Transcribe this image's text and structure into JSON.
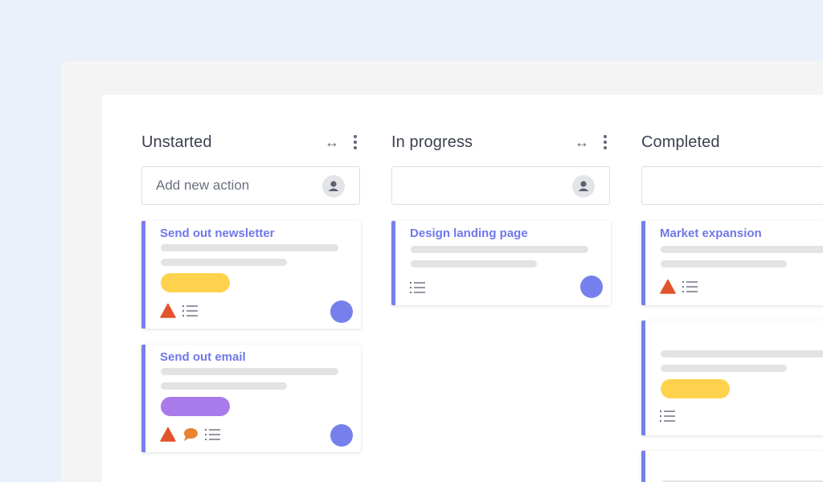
{
  "colors": {
    "accent": "#7680ec",
    "tag_yellow": "#ffd24e",
    "tag_purple": "#a97bea",
    "warning": "#e0552b",
    "comment": "#e8832e"
  },
  "columns": [
    {
      "title": "Unstarted",
      "add_placeholder": "Add new action",
      "cards": [
        {
          "title": "Send out newsletter",
          "tag": "yellow",
          "icons": [
            "warning-icon",
            "checklist-icon"
          ]
        },
        {
          "title": "Send out email",
          "tag": "purple",
          "icons": [
            "warning-icon",
            "comment-icon",
            "checklist-icon"
          ]
        }
      ]
    },
    {
      "title": "In progress",
      "add_placeholder": "",
      "cards": [
        {
          "title": "Design landing page",
          "icons": [
            "checklist-icon"
          ]
        }
      ]
    },
    {
      "title": "Completed",
      "add_placeholder": "",
      "cards": [
        {
          "title": "Market expansion",
          "icons": [
            "warning-icon",
            "checklist-icon"
          ]
        },
        {
          "title": "",
          "tag": "yellow",
          "icons": [
            "checklist-icon"
          ]
        },
        {
          "title": ""
        }
      ]
    }
  ],
  "header_icons": {
    "expand": "↔",
    "more": "more-vertical-icon"
  }
}
